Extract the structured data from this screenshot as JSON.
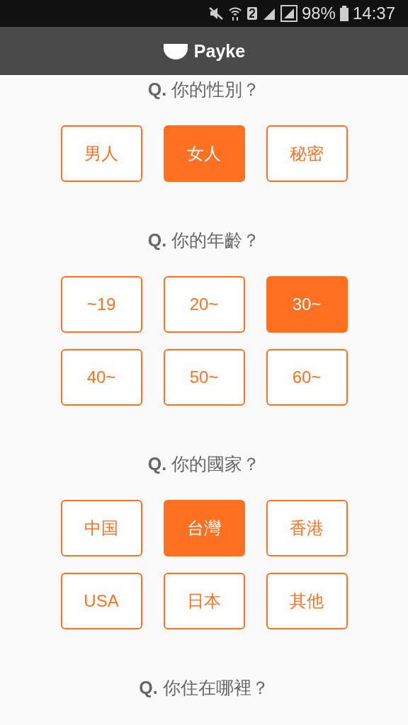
{
  "status_bar": {
    "battery": "98%",
    "time": "14:37"
  },
  "header": {
    "title": "Payke"
  },
  "questions": [
    {
      "prefix": "Q.",
      "text": "你的性別？",
      "options": [
        {
          "label": "男人",
          "selected": false
        },
        {
          "label": "女人",
          "selected": true
        },
        {
          "label": "秘密",
          "selected": false
        }
      ]
    },
    {
      "prefix": "Q.",
      "text": "你的年齡？",
      "options": [
        {
          "label": "~19",
          "selected": false
        },
        {
          "label": "20~",
          "selected": false
        },
        {
          "label": "30~",
          "selected": true
        },
        {
          "label": "40~",
          "selected": false
        },
        {
          "label": "50~",
          "selected": false
        },
        {
          "label": "60~",
          "selected": false
        }
      ]
    },
    {
      "prefix": "Q.",
      "text": "你的國家？",
      "options": [
        {
          "label": "中国",
          "selected": false
        },
        {
          "label": "台灣",
          "selected": true
        },
        {
          "label": "香港",
          "selected": false
        },
        {
          "label": "USA",
          "selected": false
        },
        {
          "label": "日本",
          "selected": false
        },
        {
          "label": "其他",
          "selected": false
        }
      ]
    },
    {
      "prefix": "Q.",
      "text": "你住在哪裡？"
    }
  ]
}
